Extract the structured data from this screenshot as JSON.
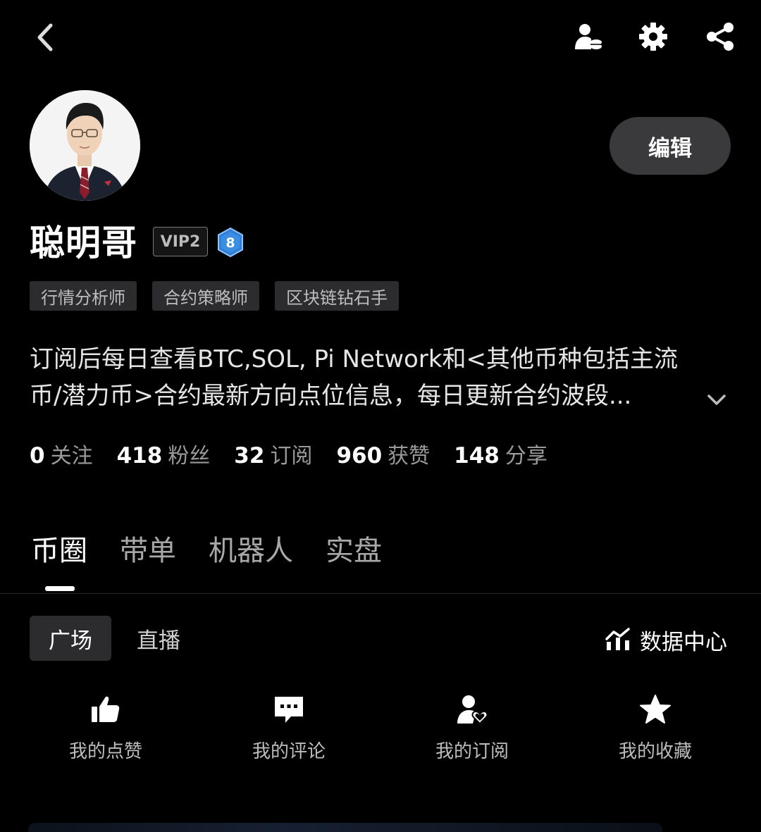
{
  "header": {
    "back_icon": "chevron-left-icon",
    "icons": [
      "user-coin-icon",
      "gear-icon",
      "share-icon"
    ]
  },
  "profile": {
    "username": "聪明哥",
    "vip": "VIP2",
    "level": "8",
    "edit_label": "编辑",
    "tags": [
      "行情分析师",
      "合约策略师",
      "区块链钻石手"
    ],
    "bio_line1": "订阅后每日查看BTC,SOL, Pi Network和<其他币种包括主流",
    "bio_line2": "币/潜力币>合约最新方向点位信息，每日更新合约波段..."
  },
  "stats": [
    {
      "num": "0",
      "label": "关注"
    },
    {
      "num": "418",
      "label": "粉丝"
    },
    {
      "num": "32",
      "label": "订阅"
    },
    {
      "num": "960",
      "label": "获赞"
    },
    {
      "num": "148",
      "label": "分享"
    }
  ],
  "main_tabs": [
    "币圈",
    "带单",
    "机器人",
    "实盘"
  ],
  "sub_tabs": {
    "active": "广场",
    "other": "直播"
  },
  "data_center": "数据中心",
  "actions": [
    {
      "label": "我的点赞",
      "icon": "thumbs-up-icon"
    },
    {
      "label": "我的评论",
      "icon": "comment-icon"
    },
    {
      "label": "我的订阅",
      "icon": "user-heart-icon"
    },
    {
      "label": "我的收藏",
      "icon": "star-icon"
    }
  ],
  "colors": {
    "background": "#000000",
    "tag_bg": "#2c2c2e",
    "level_badge": "#3b8fe0"
  }
}
